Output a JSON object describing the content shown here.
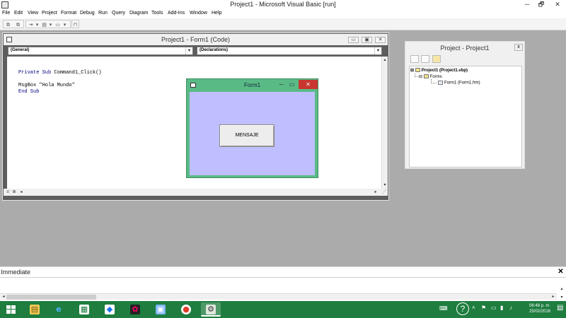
{
  "app": {
    "title": "Project1 - Microsoft Visual Basic [run]",
    "controls": {
      "minimize": "─",
      "restore": "🗗",
      "close": "✕"
    }
  },
  "menu": [
    "File",
    "Edit",
    "View",
    "Project",
    "Format",
    "Debug",
    "Run",
    "Query",
    "Diagram",
    "Tools",
    "Add-Ins",
    "Window",
    "Help"
  ],
  "code_window": {
    "title": "Project1 - Form1 (Code)",
    "object_combo": "(General)",
    "procedure_combo": "(Declarations)",
    "code_lines": [
      {
        "prefix": "Private Sub ",
        "rest": "Command1_Click()"
      },
      {
        "prefix": "",
        "rest": "MsgBox \"Hola Mundo\""
      },
      {
        "prefix": "End Sub",
        "rest": ""
      }
    ]
  },
  "form1": {
    "title": "Form1",
    "button_label": "MENSAJE",
    "client_color": "#BFBFFF",
    "frame_color": "#5ABA86"
  },
  "project_explorer": {
    "title": "Project - Project1",
    "close_label": "x",
    "tree": {
      "root": "Project1 (Project1.vbp)",
      "folder": "Forms",
      "item": "Form1 (Form1.frm)"
    }
  },
  "immediate": {
    "title": "Immediate",
    "close_label": "✕"
  },
  "taskbar": {
    "clock_time": "06:48 p. m.",
    "clock_date": "25/02/2016",
    "apps": [
      "file-explorer",
      "internet-explorer",
      "store",
      "dropbox",
      "photos",
      "remote-desktop",
      "chrome",
      "visual-basic"
    ]
  },
  "colors": {
    "taskbar": "#1E7D3F",
    "workspace": "#ABABAB",
    "form_close": "#C7372F",
    "keyword": "#00007F"
  }
}
